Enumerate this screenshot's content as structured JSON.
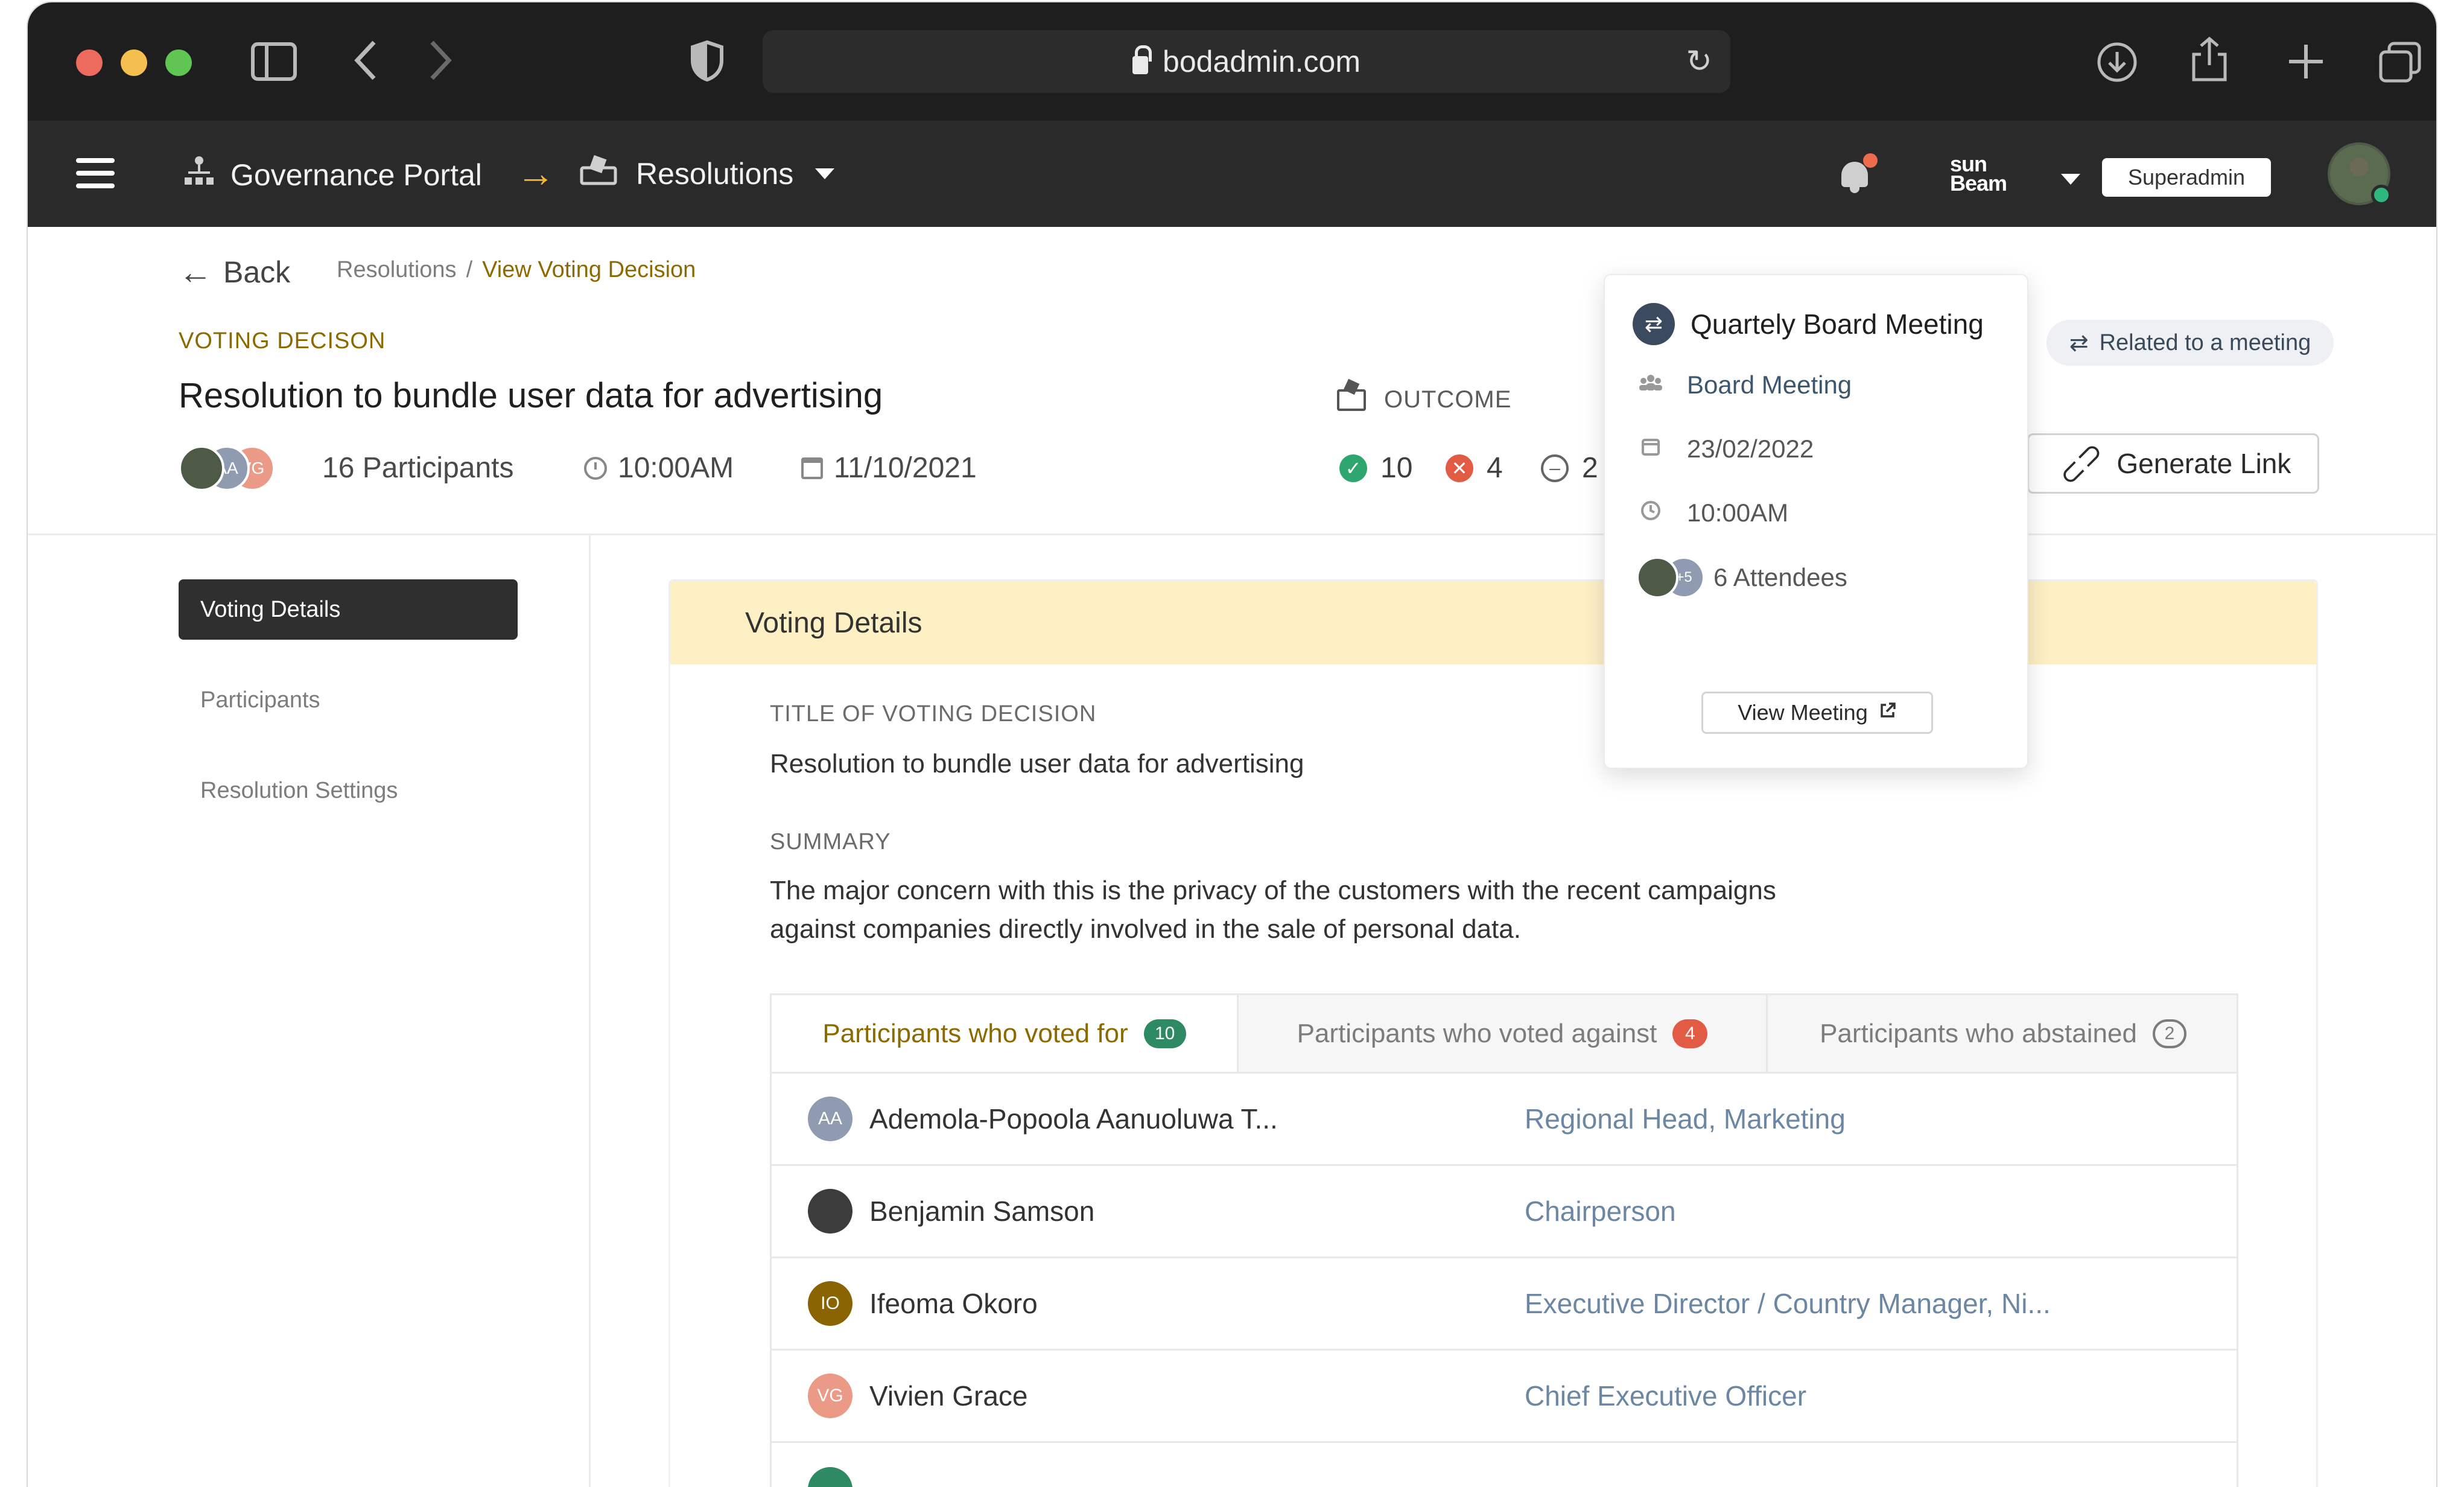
{
  "browser": {
    "url": "bodadmin.com"
  },
  "navbar": {
    "portal": "Governance Portal",
    "section": "Resolutions",
    "brand_line1": "sun",
    "brand_line2": "Beam",
    "role": "Superadmin"
  },
  "header": {
    "back": "Back",
    "breadcrumb_root": "Resolutions",
    "breadcrumb_sep": "/",
    "breadcrumb_current": "View Voting Decision",
    "kicker": "VOTING DECISON",
    "title": "Resolution to bundle user data for advertising",
    "participants": "16 Participants",
    "time": "10:00AM",
    "date": "11/10/2021",
    "avatar_initials": [
      "AA",
      "VG"
    ],
    "outcome_label": "OUTCOME",
    "votes_for": "10",
    "votes_against": "4",
    "votes_abstained": "2",
    "related_label": "Related to a meeting",
    "generate_link": "Generate Link"
  },
  "meeting_popover": {
    "title": "Quartely Board Meeting",
    "type": "Board Meeting",
    "date": "23/02/2022",
    "time": "10:00AM",
    "extra_count": "+5",
    "attendees": "6 Attendees",
    "view_button": "View Meeting"
  },
  "sidebar": {
    "items": [
      {
        "label": "Voting Details"
      },
      {
        "label": "Participants"
      },
      {
        "label": "Resolution Settings"
      }
    ]
  },
  "panel": {
    "heading": "Voting Details",
    "title_label": "TITLE OF VOTING DECISION",
    "title_value": "Resolution to bundle user data for advertising",
    "summary_label": "SUMMARY",
    "summary_line1": "The major concern with this is the privacy of the customers with the recent campaigns",
    "summary_line2": "against companies directly involved in the sale of personal data."
  },
  "tabs": [
    {
      "label": "Participants who voted for",
      "count": "10"
    },
    {
      "label": "Participants who voted against",
      "count": "4"
    },
    {
      "label": "Participants who abstained",
      "count": "2"
    }
  ],
  "participants": [
    {
      "initials": "AA",
      "name": "Ademola-Popoola Aanuoluwa T...",
      "role": "Regional Head, Marketing",
      "color": "#8e9bb0"
    },
    {
      "initials": "",
      "name": "Benjamin Samson",
      "role": "Chairperson",
      "color": "#3c3c3c"
    },
    {
      "initials": "IO",
      "name": "Ifeoma Okoro",
      "role": "Executive Director / Country Manager, Ni...",
      "color": "#8a6400"
    },
    {
      "initials": "VG",
      "name": "Vivien Grace",
      "role": "Chief Executive Officer",
      "color": "#ea9a86"
    }
  ],
  "colors": {
    "accent_gold": "#8c6a00",
    "navbar": "#2a2a2a",
    "panel_header": "#fdf0c5",
    "for_green": "#2fa56f",
    "against_red": "#e25b45"
  }
}
